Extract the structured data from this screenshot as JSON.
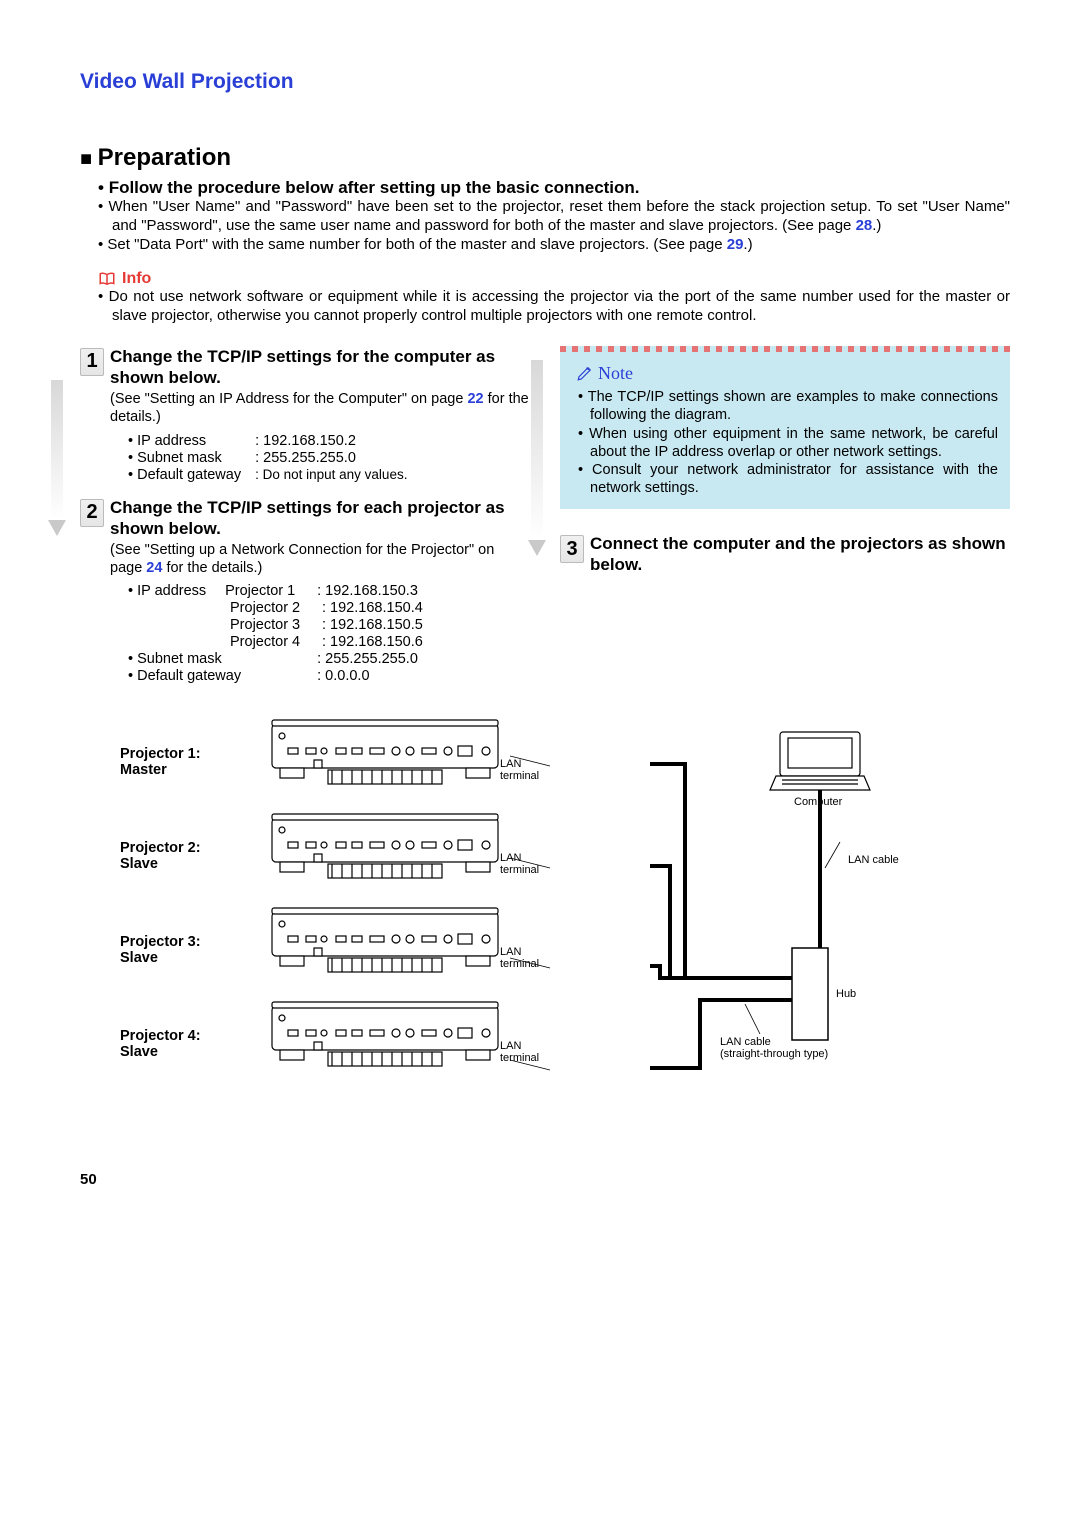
{
  "page": {
    "section_title": "Video Wall Projection",
    "heading": "Preparation",
    "lead": "Follow the procedure below after setting up the basic connection.",
    "bullets": [
      "When \"User Name\" and \"Password\" have been set to the projector, reset them before the stack projection setup. To set \"User Name\" and \"Password\", use the same user name and password for both of the master and slave projectors. (See page ",
      "Set \"Data Port\" with the same number for both of the master and slave projectors. (See page "
    ],
    "bullet_link1": "28",
    "bullet_link2": "29",
    "close_paren": ".)"
  },
  "info": {
    "label": "Info",
    "text": "Do not use network software or equipment while it is accessing the projector via the port of the same number used for the master or slave projector, otherwise you cannot properly control multiple projectors with one remote control."
  },
  "steps": {
    "s1": {
      "num": "1",
      "title": "Change the TCP/IP settings for the computer as shown below.",
      "sub_a": "(See \"Setting an IP Address for the Computer\" on page ",
      "sub_link": "22",
      "sub_b": " for the details.)",
      "settings": {
        "ip_label": "IP address",
        "ip_value": ": 192.168.150.2",
        "mask_label": "Subnet mask",
        "mask_value": ": 255.255.255.0",
        "gw_label": "Default gateway",
        "gw_value": ": Do not input any values."
      }
    },
    "s2": {
      "num": "2",
      "title": "Change the TCP/IP settings for each projector as shown below.",
      "sub_a": "(See \"Setting up a Network Connection for the Projector\" on page ",
      "sub_link": "24",
      "sub_b": " for the details.)",
      "ip_label": "IP address",
      "projectors": [
        {
          "name": "Projector 1",
          "ip": ": 192.168.150.3"
        },
        {
          "name": "Projector 2",
          "ip": ": 192.168.150.4"
        },
        {
          "name": "Projector 3",
          "ip": ": 192.168.150.5"
        },
        {
          "name": "Projector 4",
          "ip": ": 192.168.150.6"
        }
      ],
      "mask_label": "Subnet mask",
      "mask_value": ": 255.255.255.0",
      "gw_label": "Default gateway",
      "gw_value": ": 0.0.0.0"
    },
    "s3": {
      "num": "3",
      "title": "Connect the computer and the projectors as shown below."
    }
  },
  "note": {
    "label": "Note",
    "items": [
      "The TCP/IP settings shown are examples to make connections following the diagram.",
      "When using other equipment in the same network, be careful about the IP address overlap or other network settings.",
      "Consult your network administrator for assistance with the network settings."
    ]
  },
  "diagram": {
    "projectors": [
      {
        "label": "Projector 1:",
        "role": "Master"
      },
      {
        "label": "Projector 2:",
        "role": "Slave"
      },
      {
        "label": "Projector 3:",
        "role": "Slave"
      },
      {
        "label": "Projector 4:",
        "role": "Slave"
      }
    ],
    "lan_terminal": "LAN terminal",
    "computer": "Computer",
    "lan_cable": "LAN cable",
    "hub": "Hub",
    "lan_cable_straight_a": "LAN cable",
    "lan_cable_straight_b": "(straight-through type)"
  },
  "page_number": "50"
}
